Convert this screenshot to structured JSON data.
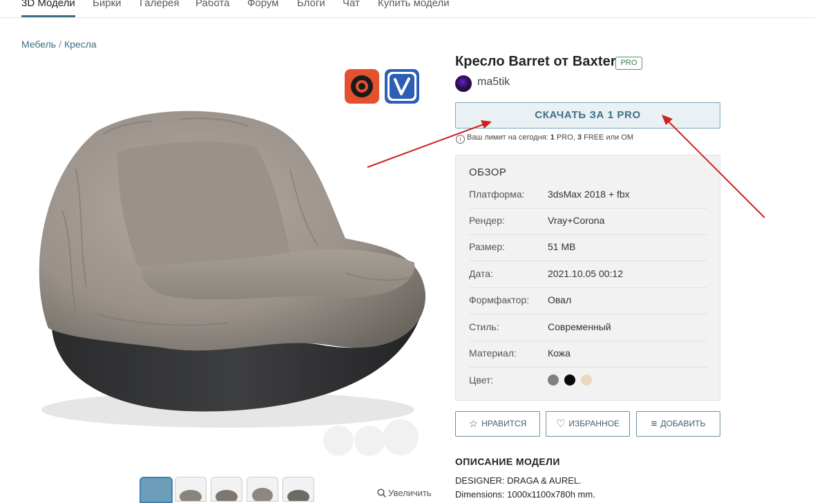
{
  "nav": {
    "items": [
      "3D Модели",
      "Бирки",
      "Галерея",
      "Работа",
      "Форум",
      "Блоги",
      "Чат",
      "Купить модели"
    ]
  },
  "breadcrumb": {
    "items": [
      "Мебель",
      "Кресла"
    ],
    "separator": "/"
  },
  "product": {
    "title": "Кресло Barret от Baxter",
    "badge": "PRO",
    "author": "ma5tik",
    "download_label": "СКАЧАТЬ ЗА 1 PRO",
    "limit": {
      "prefix": "Ваш лимит на сегодня:",
      "pro_count": "1",
      "pro_label": "PRO,",
      "free_count": "3",
      "free_suffix": "FREE или ОМ"
    }
  },
  "render_badges": [
    "corona-render-icon",
    "vray-render-icon"
  ],
  "gallery": {
    "thumbnail_count": 5,
    "zoom_label": "Увеличить"
  },
  "overview": {
    "title": "ОБЗОР",
    "rows": [
      {
        "label": "Платформа:",
        "value": "3dsMax 2018 + fbx"
      },
      {
        "label": "Рендер:",
        "value": "Vray+Corona"
      },
      {
        "label": "Размер:",
        "value": "51 MB"
      },
      {
        "label": "Дата:",
        "value": "2021.10.05 00:12"
      },
      {
        "label": "Формфактор:",
        "value": "Овал"
      },
      {
        "label": "Стиль:",
        "value": "Современный"
      },
      {
        "label": "Материал:",
        "value": "Кожа"
      },
      {
        "label": "Цвет:",
        "value": ""
      }
    ],
    "colors": [
      "#808080",
      "#0a0a0a",
      "#ead9c1"
    ]
  },
  "actions": {
    "like": "НРАВИТСЯ",
    "favorite": "ИЗБРАННОЕ",
    "add": "ДОБАВИТЬ"
  },
  "description": {
    "title": "ОПИСАНИЕ МОДЕЛИ",
    "lines": [
      "DESIGNER: DRAGA & AUREL.",
      "Dimensions: 1000x1100x780h mm."
    ]
  },
  "colors": {
    "accent": "#3f6f86",
    "annotation_arrow": "#d11f1f"
  }
}
